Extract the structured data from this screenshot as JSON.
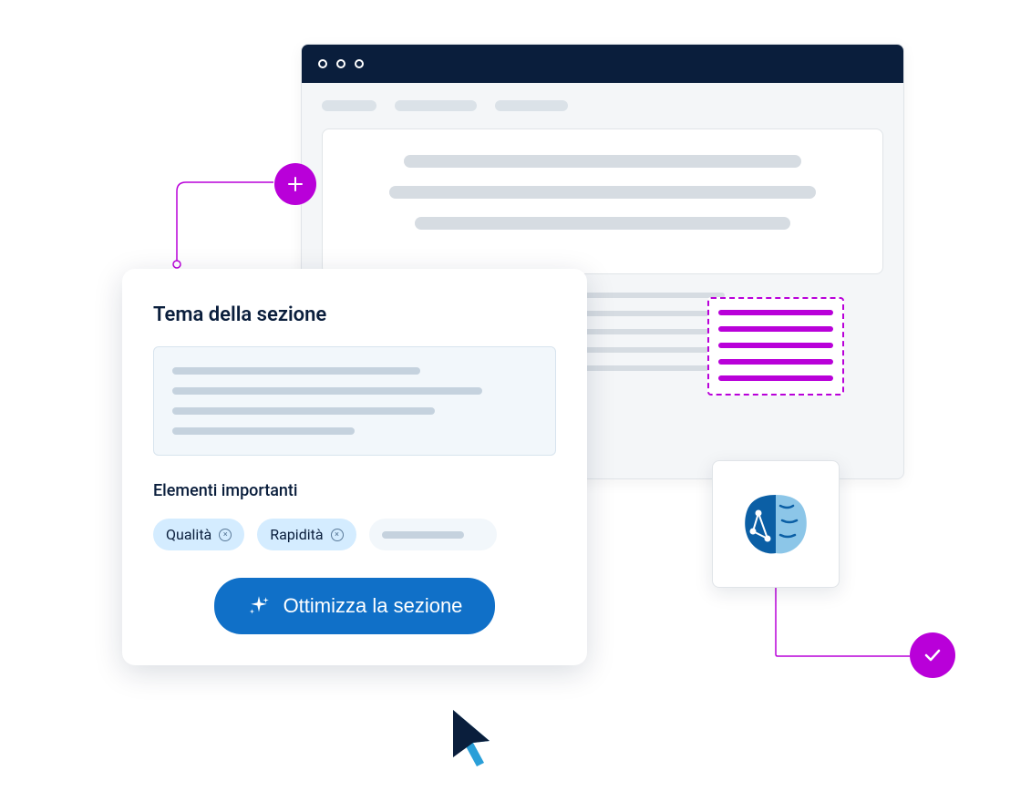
{
  "popup": {
    "title": "Tema della sezione",
    "subtitle": "Elementi importanti",
    "chips": [
      {
        "label": "Qualità"
      },
      {
        "label": "Rapidità"
      }
    ],
    "button_label": "Ottimizza la sezione"
  },
  "icons": {
    "plus": "plus",
    "check": "check",
    "sparkle": "sparkle",
    "brain": "brain",
    "cursor": "cursor"
  },
  "colors": {
    "accent_purple": "#b900d9",
    "primary_blue": "#1070c8",
    "dark_navy": "#0a1e3c",
    "chip_bg": "#d4ecff"
  }
}
